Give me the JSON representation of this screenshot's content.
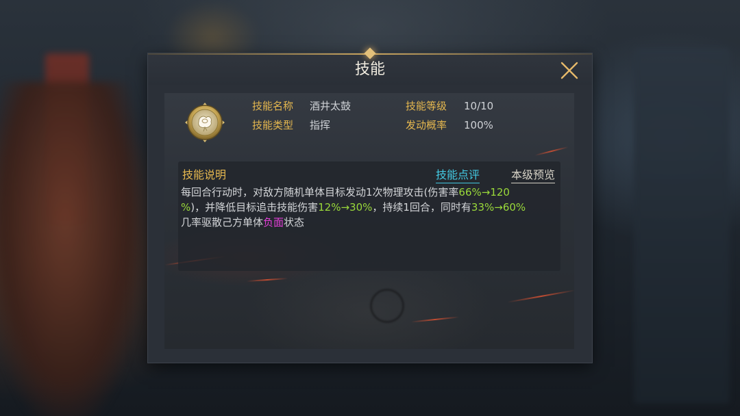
{
  "dialog": {
    "title": "技能",
    "close_icon": "close-icon"
  },
  "skill": {
    "icon": "rose-emblem-icon",
    "name_label": "技能名称",
    "name_value": "酒井太鼓",
    "level_label": "技能等级",
    "level_value": "10/10",
    "type_label": "技能类型",
    "type_value": "指挥",
    "chance_label": "发动概率",
    "chance_value": "100%"
  },
  "description": {
    "title": "技能说明",
    "review_link": "技能点评",
    "preview_link": "本级预览",
    "lines": [
      [
        {
          "text": "每回合行动时，对敌方随机单体目标发动1次物理攻击(伤害率",
          "style": "normal"
        },
        {
          "text": "66%→120",
          "style": "green"
        }
      ],
      [
        {
          "text": "%",
          "style": "green"
        },
        {
          "text": ")，并降低目标追击技能伤害",
          "style": "normal"
        },
        {
          "text": "12%→30%",
          "style": "green"
        },
        {
          "text": "，持续1回合，同时有",
          "style": "normal"
        },
        {
          "text": "33%→60%",
          "style": "green"
        }
      ],
      [
        {
          "text": "几率驱散己方单体",
          "style": "normal"
        },
        {
          "text": "负面",
          "style": "magenta"
        },
        {
          "text": "状态",
          "style": "normal"
        }
      ]
    ]
  },
  "colors": {
    "label_gold": "#e6b84f",
    "value_gray": "#cfd2d6",
    "link_cyan": "#43c9e2",
    "highlight_green": "#9ad93a",
    "highlight_magenta": "#e43fd9"
  }
}
